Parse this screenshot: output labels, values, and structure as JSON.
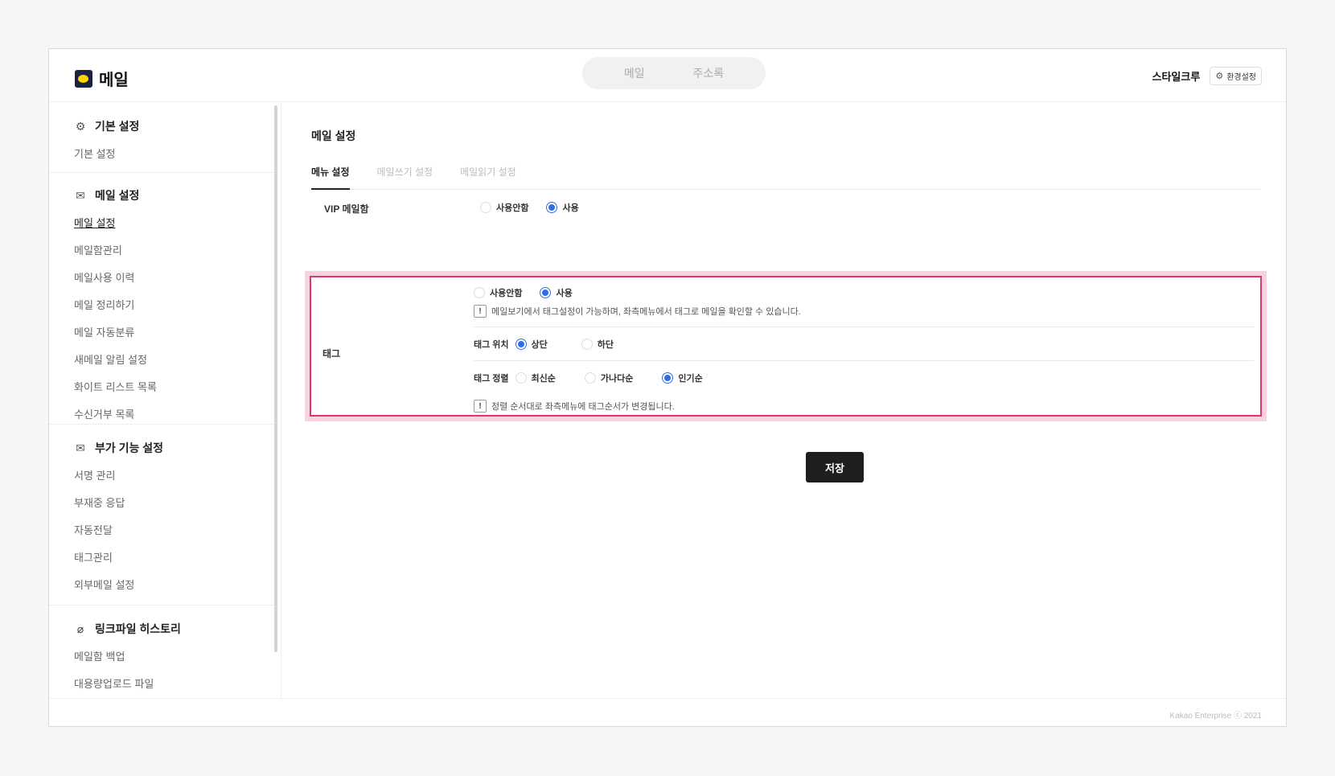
{
  "app": {
    "title": "메일"
  },
  "top_tabs": [
    {
      "label": "메일"
    },
    {
      "label": "주소록"
    }
  ],
  "user": {
    "name": "스타일크루",
    "settings_label": "환경설정"
  },
  "sidebar": {
    "groups": [
      {
        "title": "기본 설정",
        "icon": "gear-icon",
        "items": [
          "기본 설정"
        ]
      },
      {
        "title": "메일 설정",
        "icon": "mail-settings-icon",
        "items": [
          "메일 설정",
          "메일함관리",
          "메일사용 이력",
          "메일 정리하기",
          "메일 자동분류",
          "새메일 알림 설정",
          "화이트 리스트 목록",
          "수신거부 목록"
        ],
        "active": "메일 설정"
      },
      {
        "title": "부가 기능 설정",
        "icon": "mail-plus-icon",
        "items": [
          "서명 관리",
          "부재중 응답",
          "자동전달",
          "태그관리",
          "외부메일 설정"
        ]
      },
      {
        "title": "링크파일 히스토리",
        "icon": "paperclip-icon",
        "items": [
          "메일함 백업",
          "대용량업로드 파일"
        ]
      }
    ]
  },
  "main": {
    "title": "메일 설정",
    "tabs": [
      {
        "label": "메뉴 설정",
        "active": true
      },
      {
        "label": "메일쓰기 설정"
      },
      {
        "label": "메일읽기 설정"
      }
    ],
    "vip": {
      "label": "VIP 메일함",
      "options": [
        "사용안함",
        "사용"
      ],
      "selected": "사용"
    },
    "tag": {
      "label": "태그",
      "usage": {
        "options": [
          "사용안함",
          "사용"
        ],
        "selected": "사용"
      },
      "usage_note": "메일보기에서 태그설정이 가능하며, 좌측메뉴에서 태그로 메일을 확인할 수 있습니다.",
      "position": {
        "label": "태그 위치",
        "options": [
          "상단",
          "하단"
        ],
        "selected": "상단"
      },
      "sort": {
        "label": "태그 정렬",
        "options": [
          "최신순",
          "가나다순",
          "인기순"
        ],
        "selected": "인기순"
      },
      "sort_note": "정렬 순서대로 좌측메뉴에 태그순서가 변경됩니다."
    },
    "save_label": "저장"
  },
  "footer": {
    "copyright": "Kakao Enterprise ⓒ 2021"
  },
  "colors": {
    "accent": "#2f6fe6",
    "highlight_border": "#e0356e",
    "highlight_bg": "#f7d3e0",
    "button": "#1e1e1e"
  }
}
